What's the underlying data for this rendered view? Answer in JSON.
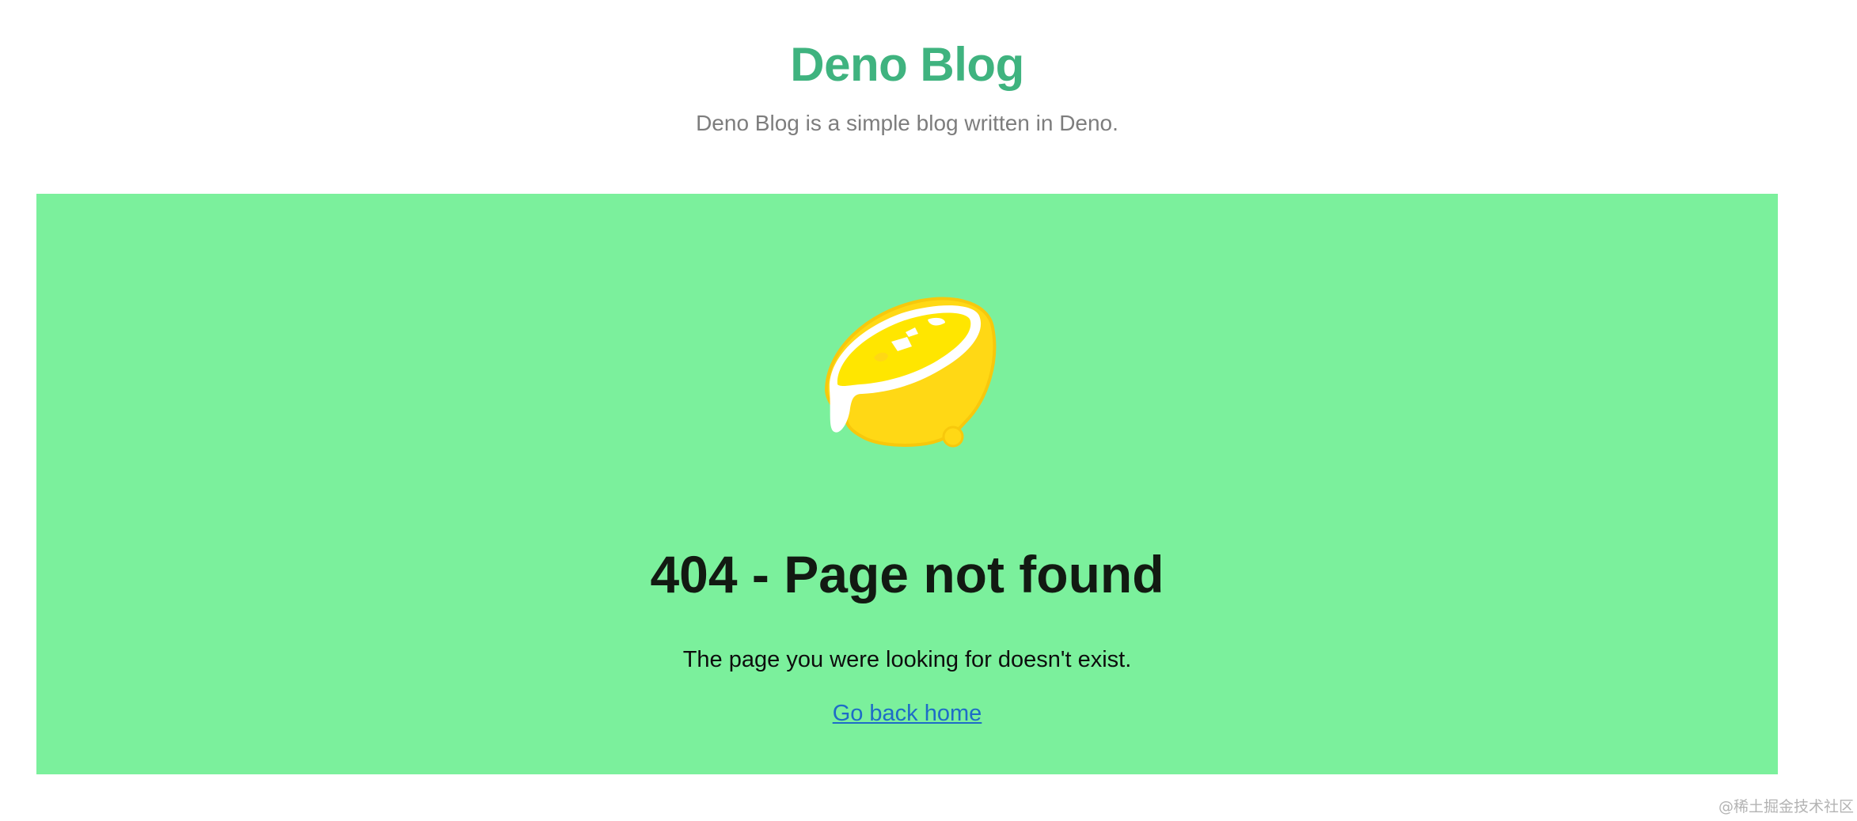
{
  "header": {
    "title": "Deno Blog",
    "subtitle": "Deno Blog is a simple blog written in Deno."
  },
  "error": {
    "illustration_icon": "lemon-icon",
    "heading": "404 - Page not found",
    "message": "The page you were looking for doesn't exist.",
    "home_link_label": "Go back home"
  },
  "watermark": "@稀土掘金技术社区",
  "colors": {
    "title": "#3fb37f",
    "subtitle": "#7d7d7d",
    "panel_background": "#7bf09c",
    "lemon_peel": "#ffd815",
    "lemon_flesh": "#ffe600",
    "link": "#1e6cc7"
  }
}
